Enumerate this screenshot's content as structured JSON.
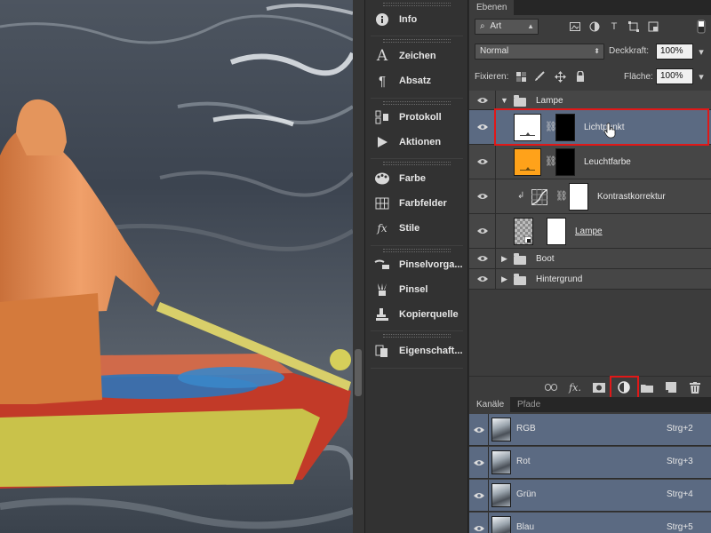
{
  "dock": {
    "items": [
      {
        "label": "Info",
        "icon": "info-icon"
      },
      {
        "label": "Zeichen",
        "icon": "character-icon"
      },
      {
        "label": "Absatz",
        "icon": "paragraph-icon"
      },
      {
        "label": "Protokoll",
        "icon": "history-icon"
      },
      {
        "label": "Aktionen",
        "icon": "actions-play-icon"
      },
      {
        "label": "Farbe",
        "icon": "color-palette-icon"
      },
      {
        "label": "Farbfelder",
        "icon": "swatches-icon"
      },
      {
        "label": "Stile",
        "icon": "styles-fx-icon"
      },
      {
        "label": "Pinselvorga...",
        "icon": "brush-presets-icon"
      },
      {
        "label": "Pinsel",
        "icon": "brush-icon"
      },
      {
        "label": "Kopierquelle",
        "icon": "clone-source-icon"
      },
      {
        "label": "Eigenschaft...",
        "icon": "properties-icon"
      }
    ]
  },
  "layers_panel": {
    "tab": "Ebenen",
    "filter": {
      "value": "Art",
      "icon": "search-icon"
    },
    "blend_mode": "Normal",
    "opacity_label": "Deckkraft:",
    "opacity_value": "100%",
    "lock_label": "Fixieren:",
    "fill_label": "Fläche:",
    "fill_value": "100%",
    "layers": [
      {
        "name": "Lampe",
        "kind": "group",
        "expanded": true
      },
      {
        "name": "Lichtpunkt",
        "kind": "fill",
        "selected": true
      },
      {
        "name": "Leuchtfarbe",
        "kind": "fill",
        "swatch": "#ffa21a"
      },
      {
        "name": "Kontrastkorrektur",
        "kind": "adjustment"
      },
      {
        "name": "Lampe",
        "kind": "smart"
      },
      {
        "name": "Boot",
        "kind": "group",
        "expanded": false
      },
      {
        "name": "Hintergrund",
        "kind": "group",
        "expanded": false
      }
    ]
  },
  "channels_panel": {
    "tabs": [
      "Kanäle",
      "Pfade"
    ],
    "channels": [
      {
        "name": "RGB",
        "shortcut": "Strg+2"
      },
      {
        "name": "Rot",
        "shortcut": "Strg+3"
      },
      {
        "name": "Grün",
        "shortcut": "Strg+4"
      },
      {
        "name": "Blau",
        "shortcut": "Strg+5"
      }
    ]
  },
  "colors": {
    "highlight": "#e01818",
    "selected_row": "#5b6a82",
    "panel_bg": "#3c3c3c"
  }
}
